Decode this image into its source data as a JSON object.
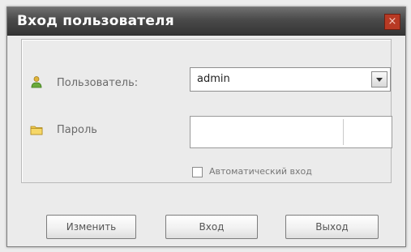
{
  "window": {
    "title": "Вход пользователя",
    "close_glyph": "×"
  },
  "form": {
    "user_label": "Пользователь:",
    "user_value": "admin",
    "user_icon": "user-icon",
    "password_label": "Пароль",
    "password_value": "",
    "password_icon": "folder-key-icon",
    "auto_login_label": "Автоматический вход",
    "auto_login_checked": false
  },
  "buttons": {
    "change_label": "Изменить",
    "login_label": "Вход",
    "exit_label": "Выход"
  },
  "colors": {
    "titlebar": "#4a4a4a",
    "close": "#b83a24",
    "background": "#ebebeb"
  }
}
